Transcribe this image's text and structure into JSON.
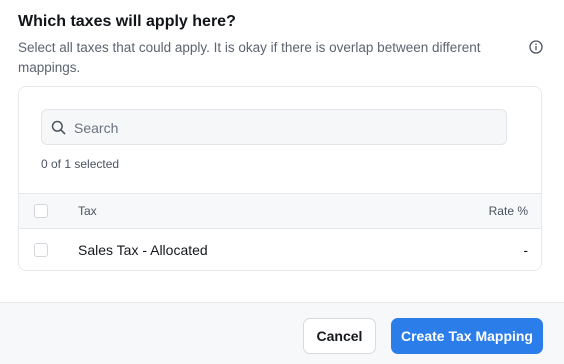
{
  "dialog": {
    "title": "Which taxes will apply here?",
    "description": "Select all taxes that could apply. It is okay if there is overlap between different mappings.",
    "info_icon": "info-circle-icon"
  },
  "search": {
    "placeholder": "Search",
    "value": "",
    "icon": "search-icon"
  },
  "selection_count": "0 of 1 selected",
  "table": {
    "columns": [
      "Tax",
      "Rate %"
    ],
    "rows": [
      {
        "tax": "Sales Tax - Allocated",
        "rate": "-",
        "selected": false
      }
    ]
  },
  "footer": {
    "cancel_label": "Cancel",
    "primary_label": "Create Tax Mapping"
  },
  "colors": {
    "primary": "#2b7de9",
    "text": "#1f2328",
    "muted": "#5d6470"
  }
}
